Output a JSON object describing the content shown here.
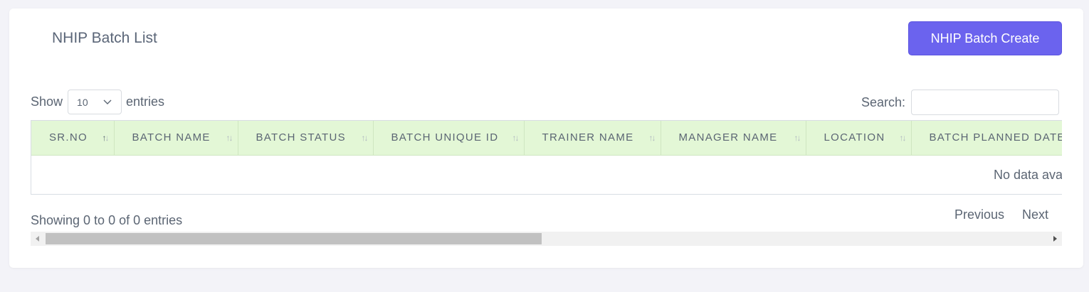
{
  "header": {
    "title": "NHIP Batch List",
    "create_button": "NHIP Batch Create"
  },
  "length": {
    "show_label": "Show",
    "value": "10",
    "entries_label": "entries"
  },
  "search": {
    "label": "Search:",
    "value": ""
  },
  "table": {
    "columns": [
      "SR.NO",
      "BATCH NAME",
      "BATCH STATUS",
      "BATCH UNIQUE ID",
      "TRAINER NAME",
      "MANAGER NAME",
      "LOCATION",
      "BATCH PLANNED DATE"
    ],
    "empty_message": "No data available in table"
  },
  "footer": {
    "info": "Showing 0 to 0 of 0 entries",
    "previous": "Previous",
    "next": "Next"
  },
  "colors": {
    "accent": "#6b63ee",
    "header_row": "#e3f7d6",
    "background": "#f3f3f8"
  }
}
